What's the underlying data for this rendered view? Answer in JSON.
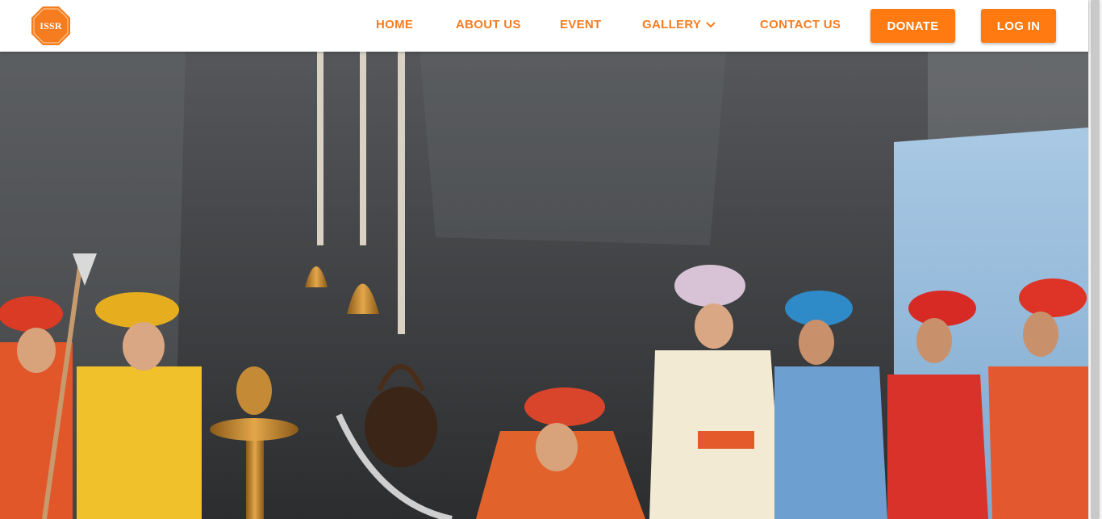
{
  "brand": {
    "logo_text": "ISSR",
    "accent": "#f57c1f",
    "button_color": "#ff7a10"
  },
  "nav": {
    "home": "HOME",
    "about": "ABOUT US",
    "event": "EVENT",
    "gallery": "GALLERY",
    "contact": "CONTACT US"
  },
  "actions": {
    "donate": "DONATE",
    "login": "LOG IN"
  },
  "hero": {
    "image_subject": "hero-sculpture-image"
  }
}
